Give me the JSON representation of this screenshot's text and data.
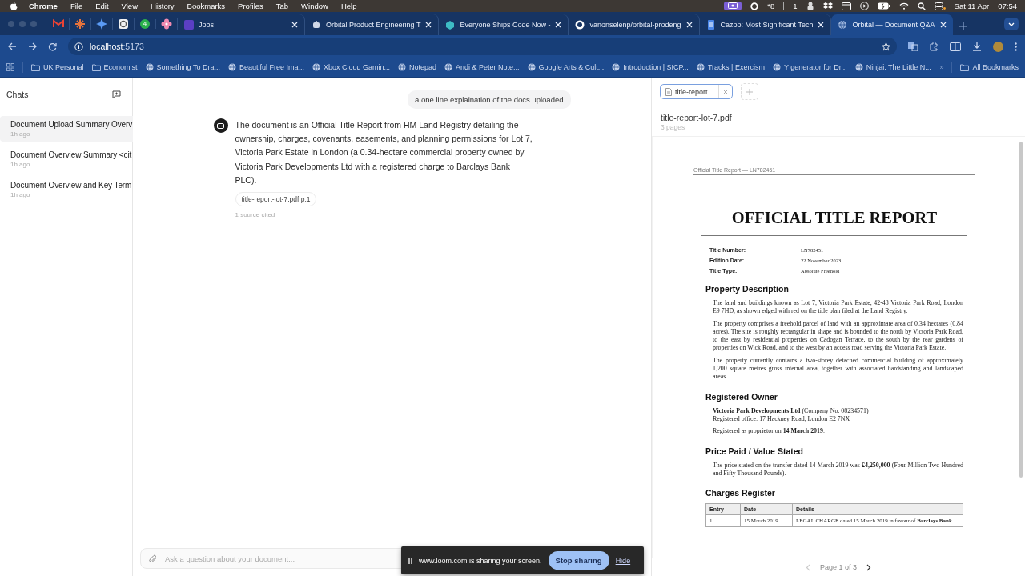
{
  "menu_bar": {
    "app": "Chrome",
    "items": [
      "File",
      "Edit",
      "View",
      "History",
      "Bookmarks",
      "Profiles",
      "Tab",
      "Window",
      "Help"
    ],
    "status_texts": [
      "*8",
      "1"
    ],
    "date": "Sat 11 Apr",
    "time": "07:54"
  },
  "browser": {
    "pinned_badge": "4",
    "tabs": [
      {
        "title": "Jobs",
        "selected": false
      },
      {
        "title": "Orbital Product Engineering T",
        "selected": false
      },
      {
        "title": "Everyone Ships Code Now -",
        "selected": false
      },
      {
        "title": "vanonselenp/orbital-prodeng",
        "selected": false
      },
      {
        "title": "Cazoo: Most Significant Tech",
        "selected": false
      },
      {
        "title": "Orbital — Document Q&A",
        "selected": true
      }
    ],
    "address": "**localhost**:5173",
    "bookmarks": [
      {
        "label": "UK Personal",
        "kind": "folder"
      },
      {
        "label": "Economist",
        "kind": "folder"
      },
      {
        "label": "Something To Dra...",
        "kind": "site"
      },
      {
        "label": "Beautiful Free Ima...",
        "kind": "site"
      },
      {
        "label": "Xbox Cloud Gamin...",
        "kind": "site"
      },
      {
        "label": "Notepad",
        "kind": "site"
      },
      {
        "label": "Andi & Peter Note...",
        "kind": "site"
      },
      {
        "label": "Google Arts & Cult...",
        "kind": "site"
      },
      {
        "label": "Introduction | SICP...",
        "kind": "site"
      },
      {
        "label": "Tracks | Exercism",
        "kind": "site"
      },
      {
        "label": "Y generator for Dr...",
        "kind": "site"
      },
      {
        "label": "Ninjai: The Little N...",
        "kind": "site"
      }
    ],
    "bookmarks_overflow": "»",
    "all_bookmarks": "All Bookmarks"
  },
  "sidebar": {
    "title": "Chats",
    "chats": [
      {
        "title": "Document Upload Summary Overv",
        "time": "1h ago",
        "selected": true
      },
      {
        "title": "Document Overview Summary <cit",
        "time": "1h ago",
        "selected": false
      },
      {
        "title": "Document Overview and Key Term",
        "time": "1h ago",
        "selected": false
      }
    ]
  },
  "conversation": {
    "messages": [
      {
        "kind": "user",
        "text": "a one line explaination of the docs uploaded"
      },
      {
        "kind": "assistant",
        "text": "The document is an Official Title Report from HM Land Registry detailing the ownership, charges, covenants, easements, and planning permissions for Lot 7, Victoria Park Estate in London (a 0.34-hectare commercial property owned by Victoria Park Developments Ltd with a registered charge to Barclays Bank PLC).",
        "citations": [
          "title-report-lot-7.pdf p.1"
        ],
        "sources_note": "1 source cited"
      }
    ],
    "composer": {
      "placeholder": "Ask a question about your document..."
    }
  },
  "share_banner": {
    "text": "www.loom.com is sharing your screen.",
    "stop": "Stop sharing",
    "hide": "Hide"
  },
  "document_panel": {
    "tabs": [
      {
        "label": "title-report...",
        "selected": true
      }
    ],
    "file_name": "title-report-lot-7.pdf",
    "page_count": "3 pages",
    "page": {
      "running_header": "Official Title Report — LN782451",
      "title": "OFFICIAL TITLE REPORT",
      "fields": [
        {
          "label": "Title Number:",
          "value": "LN782451"
        },
        {
          "label": "Edition Date:",
          "value": "22 November 2023"
        },
        {
          "label": "Title Type:",
          "value": "Absolute Freehold"
        }
      ],
      "sections": [
        {
          "heading": "Property Description",
          "paragraphs": [
            "The land and buildings known as Lot 7, Victoria Park Estate, 42-48 Victoria Park Road, London E9 7HD, as shown edged with red on the title plan filed at the Land Registry.",
            "The property comprises a freehold parcel of land with an approximate area of 0.34 hectares (0.84 acres). The site is roughly rectangular in shape and is bounded to the north by Victoria Park Road, to the east by residential properties on Cadogan Terrace, to the south by the rear gardens of properties on Wick Road, and to the west by an access road serving the Victoria Park Estate.",
            "The property currently contains a two-storey detached commercial building of approximately 1,200 square metres gross internal area, together with associated hardstanding and landscaped areas."
          ]
        },
        {
          "heading": "Registered Owner",
          "paragraphs": [
            "**Victoria Park Developments Ltd** (Company No. 08234571)\nRegistered office: 17 Hackney Road, London E2 7NX",
            "Registered as proprietor on **14 March 2019**."
          ]
        },
        {
          "heading": "Price Paid / Value Stated",
          "paragraphs": [
            "The price stated on the transfer dated 14 March 2019 was **£4,250,000** (Four Million Two Hundred and Fifty Thousand Pounds)."
          ]
        },
        {
          "heading": "Charges Register",
          "table": {
            "columns": [
              "Entry",
              "Date",
              "Details"
            ],
            "rows": [
              [
                "1",
                "15 March 2019",
                "LEGAL CHARGE dated 15 March 2019 in favour of **Barclays Bank**"
              ]
            ]
          }
        }
      ]
    },
    "pager": {
      "label": "Page 1 of 3",
      "prev_disabled": true,
      "next_disabled": false
    }
  }
}
